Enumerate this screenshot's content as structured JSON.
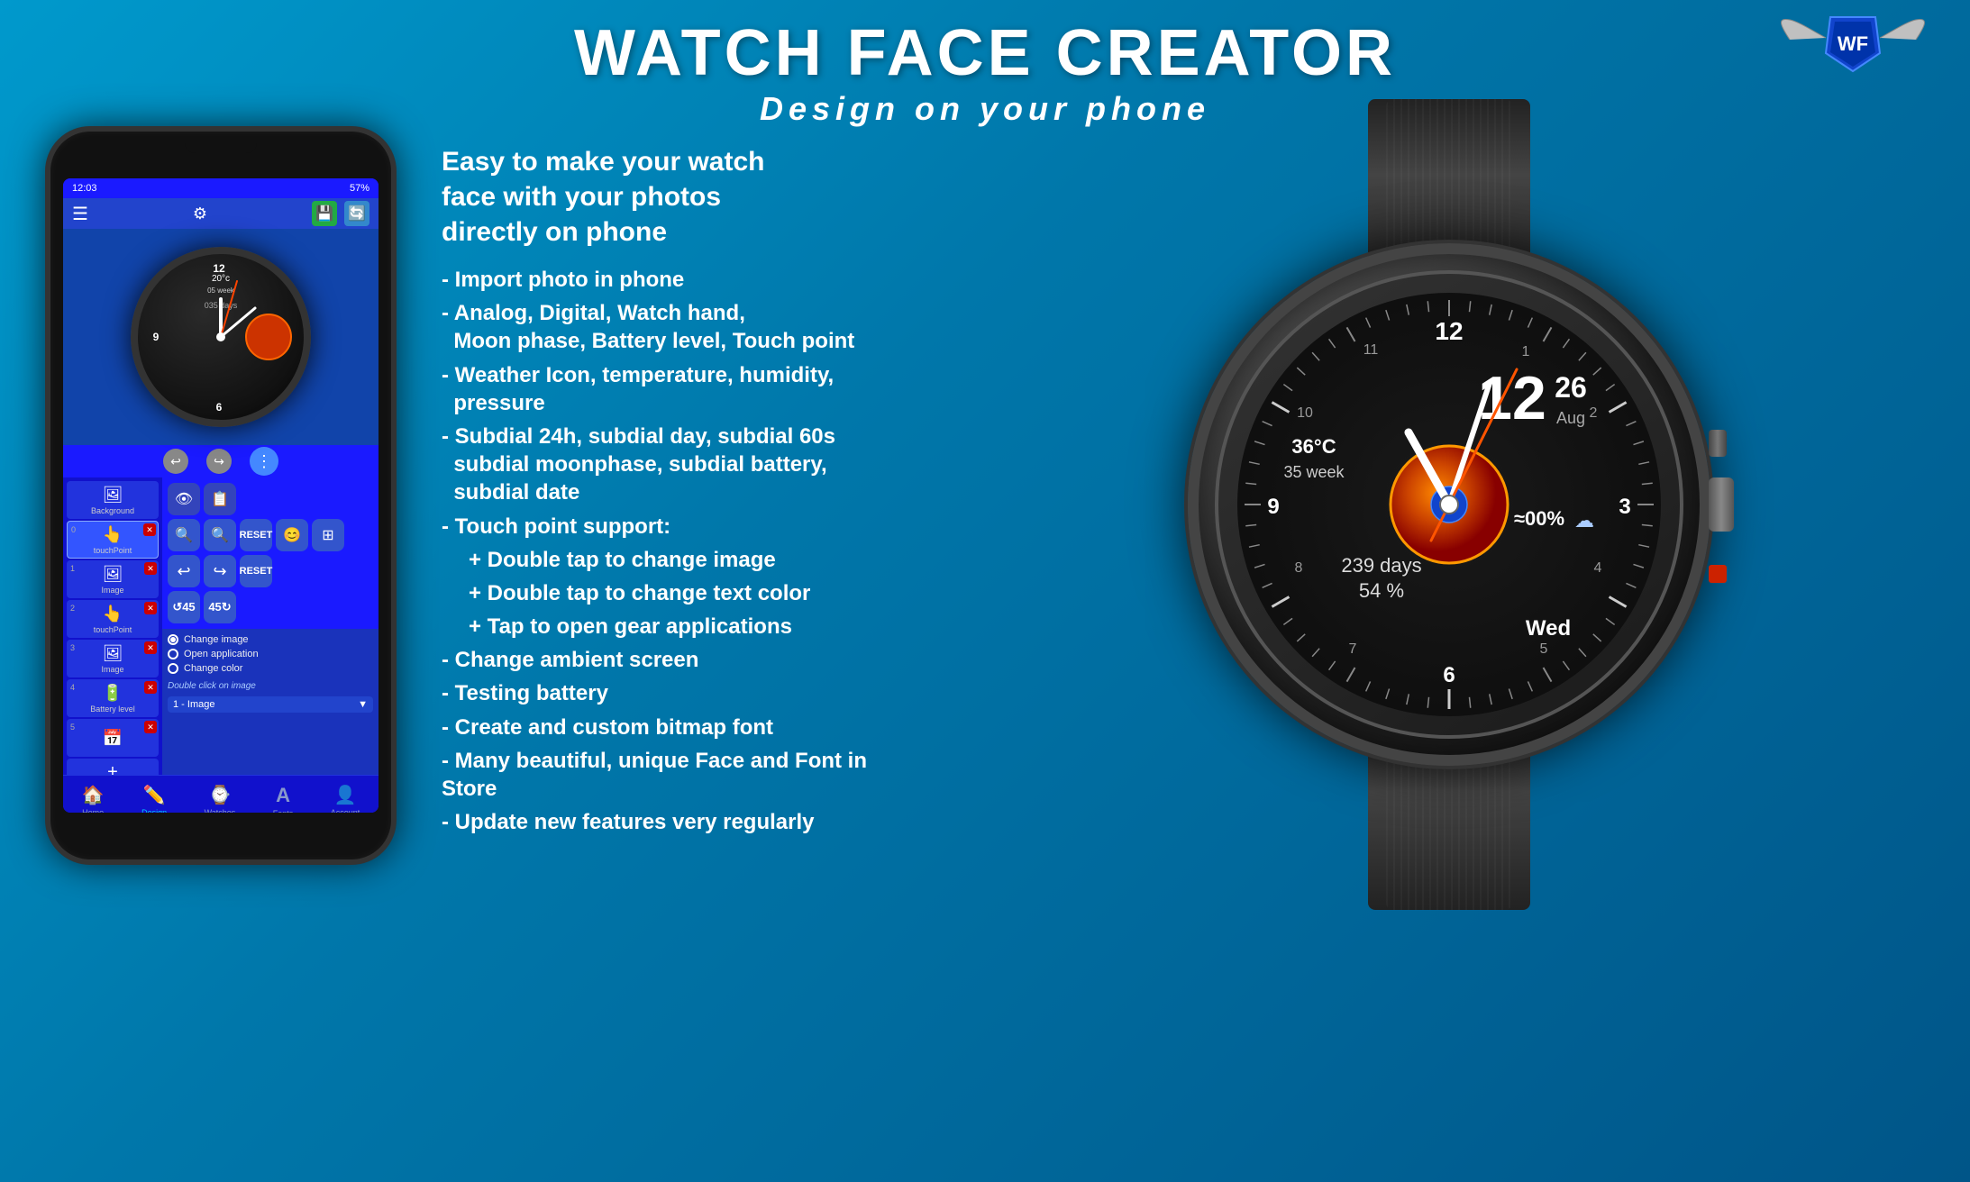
{
  "header": {
    "title": "WATCH FACE CREATOR",
    "subtitle": "Design on your phone",
    "logo_text": "WF"
  },
  "phone": {
    "status_time": "12:03",
    "battery": "57%",
    "top_bar": {
      "hamburger": "☰",
      "gear": "⚙"
    },
    "nav_items": [
      {
        "label": "Home",
        "icon": "🏠",
        "active": false
      },
      {
        "label": "Design",
        "icon": "✏️",
        "active": true
      },
      {
        "label": "Watches",
        "icon": "⌚",
        "active": false
      },
      {
        "label": "Fonts",
        "icon": "A",
        "active": false
      },
      {
        "label": "Account",
        "icon": "👤",
        "active": false
      }
    ],
    "panel_items": [
      {
        "num": "",
        "label": "Background",
        "icon": "🖼"
      },
      {
        "num": "0",
        "label": "touchPoint",
        "icon": "👆",
        "selected": true
      },
      {
        "num": "1",
        "label": "Image",
        "icon": "🖼"
      },
      {
        "num": "2",
        "label": "touchPoint",
        "icon": "👆"
      },
      {
        "num": "3",
        "label": "Image",
        "icon": "🖼"
      },
      {
        "num": "4",
        "label": "Battery level",
        "icon": "🔋"
      },
      {
        "num": "5",
        "label": "Add item",
        "icon": "+"
      }
    ],
    "touch_options": {
      "change_image": "Change image",
      "open_application": "Open application",
      "change_color": "Change color",
      "double_click_label": "Double click on image",
      "image_select": "1 - Image"
    }
  },
  "features": {
    "intro": "Easy to make your watch\n face with your photos\n directly on phone",
    "items": [
      "- Import photo in phone",
      "- Analog, Digital, Watch hand, Moon phase, Battery level, Touch point",
      "- Weather  Icon, temperature, humidity,   pressure",
      "- Subdial 24h, subdial  day, subdial  60s   subdial moonphase, subdial  battery,   subdial  date",
      "- Touch point support:",
      "  + Double tap to change image",
      "  + Double tap to change text color",
      "  + Tap to open gear applications",
      "- Change ambient screen",
      "- Testing battery",
      "- Create and custom bitmap font",
      "- Many beautiful, unique Face and Font in Store",
      "- Update new features very regularly"
    ]
  },
  "big_watch": {
    "time": "12",
    "date_day": "26",
    "date_month": "Aug",
    "temperature": "36°C",
    "week": "35 week",
    "battery_pct": "≈00%",
    "days": "239 days",
    "percent": "54 %",
    "weekday": "Wed"
  },
  "colors": {
    "background_start": "#0099cc",
    "background_end": "#005588",
    "accent_blue": "#3355ff",
    "accent_orange": "#ff6600",
    "accent_red": "#cc0000"
  }
}
